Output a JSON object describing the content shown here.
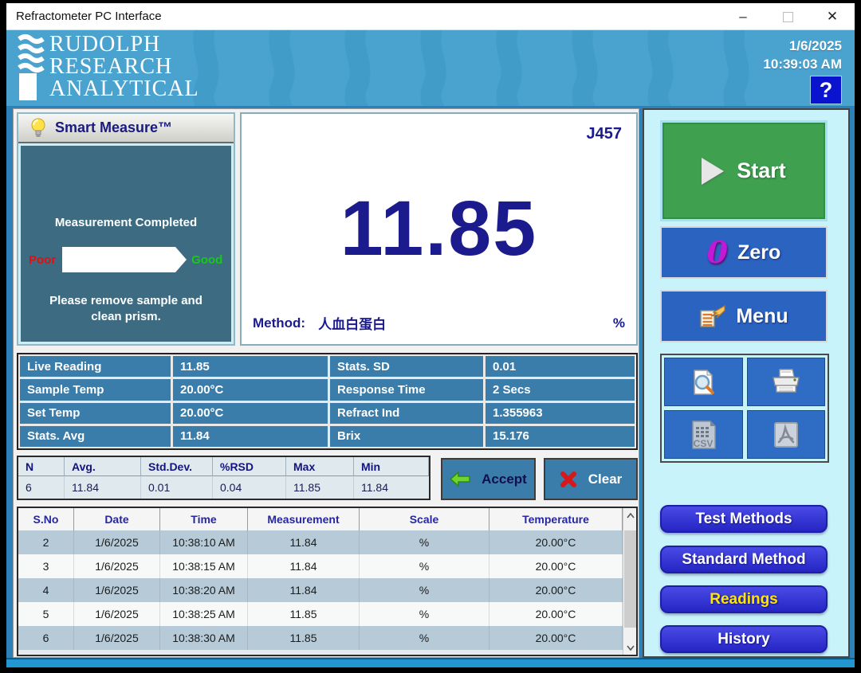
{
  "titlebar": {
    "title": "Refractometer PC Interface",
    "minimize_glyph": "–",
    "close_glyph": "✕"
  },
  "header": {
    "logo_line1": "RUDOLPH",
    "logo_line2": "RESEARCH",
    "logo_line3": "ANALYTICAL",
    "date": "1/6/2025",
    "time": "10:39:03 AM",
    "help_label": "?"
  },
  "smart_measure": {
    "title": "Smart Measure™",
    "status": "Measurement Completed",
    "scale_left": "Poor",
    "scale_right": "Good",
    "bar_fill_percent": 100,
    "bar_color": "#0a0af0",
    "instruction": "Please remove sample and clean prism."
  },
  "display": {
    "model": "J457",
    "value": "11.85",
    "method_label": "Method:",
    "method_value": "人血白蛋白",
    "unit": "%"
  },
  "live_stats": {
    "rows": [
      [
        "Live Reading",
        "11.85",
        "Stats. SD",
        "0.01"
      ],
      [
        "Sample Temp",
        "20.00°C",
        "Response Time",
        "2 Secs"
      ],
      [
        "Set Temp",
        "20.00°C",
        "Refract Ind",
        "1.355963"
      ],
      [
        "Stats. Avg",
        "11.84",
        "Brix",
        "15.176"
      ]
    ]
  },
  "summary": {
    "headers": [
      "N",
      "Avg.",
      "Std.Dev.",
      "%RSD",
      "Max",
      "Min"
    ],
    "values": [
      "6",
      "11.84",
      "0.01",
      "0.04",
      "11.85",
      "11.84"
    ],
    "accept_label": "Accept",
    "clear_label": "Clear"
  },
  "readings": {
    "headers": [
      "S.No",
      "Date",
      "Time",
      "Measurement",
      "Scale",
      "Temperature"
    ],
    "rows": [
      [
        "2",
        "1/6/2025",
        "10:38:10 AM",
        "11.84",
        "%",
        "20.00°C"
      ],
      [
        "3",
        "1/6/2025",
        "10:38:15 AM",
        "11.84",
        "%",
        "20.00°C"
      ],
      [
        "4",
        "1/6/2025",
        "10:38:20 AM",
        "11.84",
        "%",
        "20.00°C"
      ],
      [
        "5",
        "1/6/2025",
        "10:38:25 AM",
        "11.85",
        "%",
        "20.00°C"
      ],
      [
        "6",
        "1/6/2025",
        "10:38:30 AM",
        "11.85",
        "%",
        "20.00°C"
      ]
    ]
  },
  "actions": {
    "start_label": "Start",
    "zero_label": "Zero",
    "zero_glyph": "0",
    "menu_label": "Menu",
    "csv_label": "CSV",
    "nav": [
      {
        "label": "Test Methods",
        "active": false
      },
      {
        "label": "Standard Method",
        "active": false
      },
      {
        "label": "Readings",
        "active": true
      },
      {
        "label": "History",
        "active": false
      }
    ]
  },
  "icons": [
    "lightbulb-icon",
    "play-icon",
    "zero-icon",
    "menu-hand-icon",
    "print-preview-icon",
    "printer-icon",
    "csv-file-icon",
    "pdf-file-icon",
    "accept-arrow-icon",
    "clear-x-icon"
  ],
  "colors": {
    "header_blue": "#4aa3cf",
    "frame_blue": "#2e80b8",
    "panel_teal": "#3d6c82",
    "cell_blue": "#3a7dab",
    "button_blue": "#2a63c0",
    "start_green": "#3fa050",
    "nav_blue": "#3434d6",
    "nav_active_text": "#ffe600",
    "right_pane_cyan": "#c9f3fb",
    "value_navy": "#1b1b8e",
    "poor_red": "#e01010",
    "good_green": "#18c818",
    "row_alt": "#b6cad7"
  }
}
